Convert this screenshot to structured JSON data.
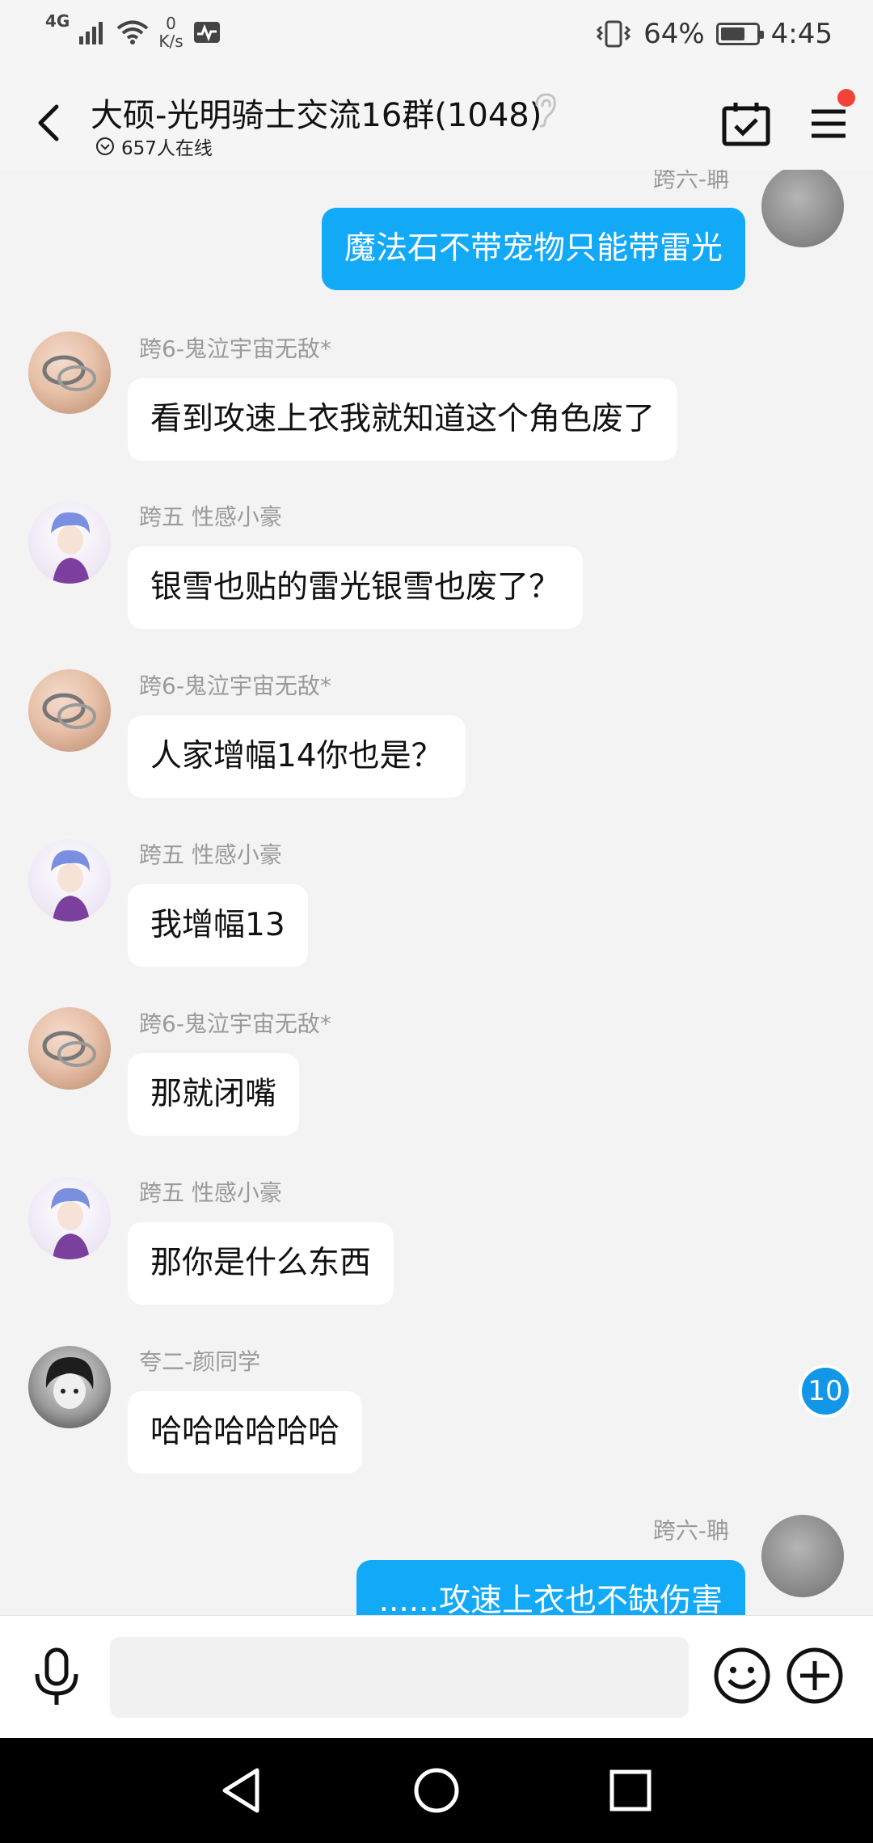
{
  "status_bar": {
    "network": "4G",
    "speed_value": "0",
    "speed_unit": "K/s",
    "battery_percent": "64%",
    "battery_level": 0.64,
    "time": "4:45"
  },
  "header": {
    "title": "大硕-光明骑士交流16群(1048)",
    "online_text": "657人在线",
    "has_notification_dot": true
  },
  "messages": [
    {
      "side": "right",
      "sender": "跨六-聃",
      "text": "魔法石不带宠物只能带雷光",
      "avatar": "grey-avatar"
    },
    {
      "side": "left",
      "sender": "跨6-鬼泣宇宙无敌*",
      "text": "看到攻速上衣我就知道这个角色废了",
      "avatar": "ring-avatar"
    },
    {
      "side": "left",
      "sender": "跨五 性感小豪",
      "text": "银雪也贴的雷光银雪也废了？",
      "avatar": "anime-avatar"
    },
    {
      "side": "left",
      "sender": "跨6-鬼泣宇宙无敌*",
      "text": "人家增幅14你也是？",
      "avatar": "ring-avatar"
    },
    {
      "side": "left",
      "sender": "跨五 性感小豪",
      "text": "我增幅13",
      "avatar": "anime-avatar"
    },
    {
      "side": "left",
      "sender": "跨6-鬼泣宇宙无敌*",
      "text": "那就闭嘴",
      "avatar": "ring-avatar"
    },
    {
      "side": "left",
      "sender": "跨五 性感小豪",
      "text": "那你是什么东西",
      "avatar": "anime-avatar"
    },
    {
      "side": "left",
      "sender": "夸二-颜同学",
      "text": "哈哈哈哈哈哈",
      "avatar": "boy-avatar"
    },
    {
      "side": "right",
      "sender": "跨六-聃",
      "text": "......攻速上衣也不缺伤害",
      "avatar": "grey-avatar"
    }
  ],
  "unread_count": "10",
  "input": {
    "value": "",
    "placeholder": ""
  },
  "colors": {
    "accent_bubble": "#12a9f7",
    "badge": "#1296e8",
    "notification_dot": "#f44336",
    "background": "#f3f3f4"
  },
  "icons": [
    "back-arrow-icon",
    "ear-icon",
    "online-chevron-icon",
    "calendar-check-icon",
    "menu-icon",
    "microphone-icon",
    "emoji-icon",
    "plus-icon",
    "nav-back-icon",
    "nav-home-icon",
    "nav-recents-icon"
  ]
}
